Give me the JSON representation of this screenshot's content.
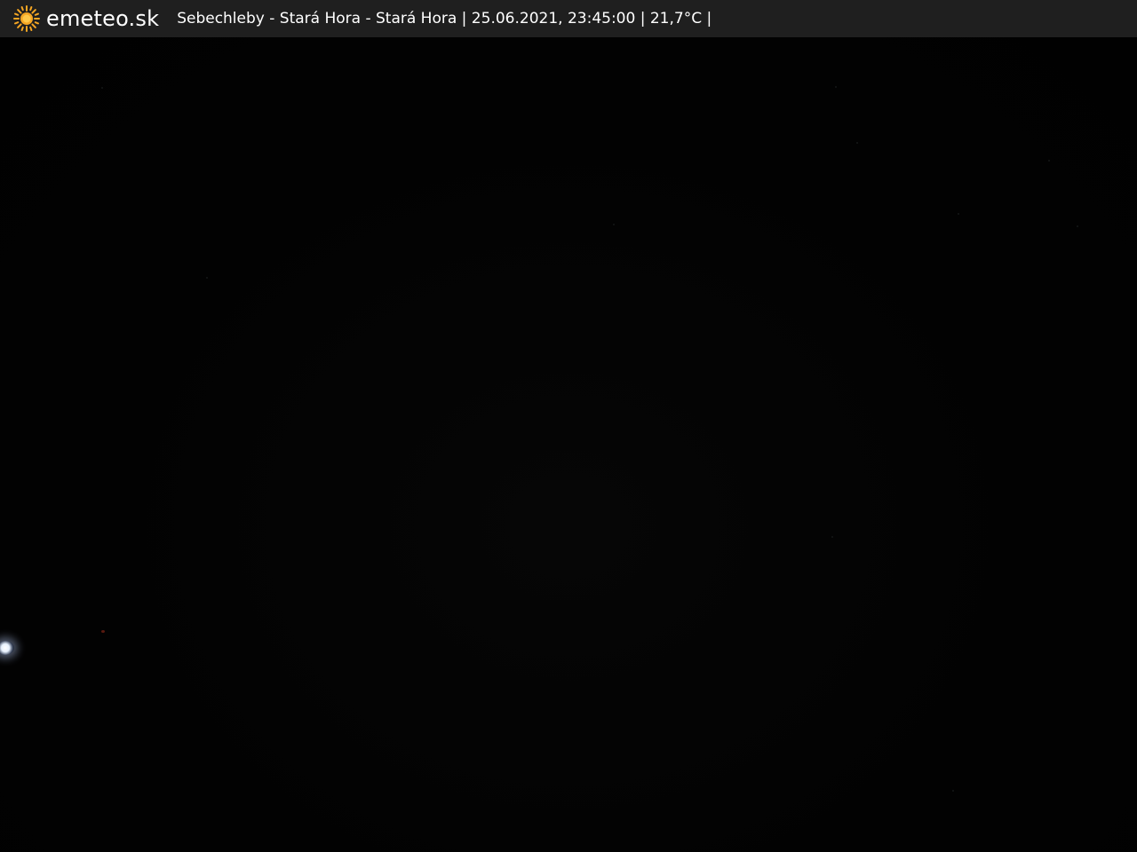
{
  "overlay": {
    "brand": "emeteo.sk",
    "caption": "Sebechleby - Stará Hora - Stará Hora | 25.06.2021, 23:45:00 | 21,7°C |",
    "logo_icon": "sun-icon",
    "logo_color": "#f5a623",
    "bar_color": "#1f1f1f"
  }
}
